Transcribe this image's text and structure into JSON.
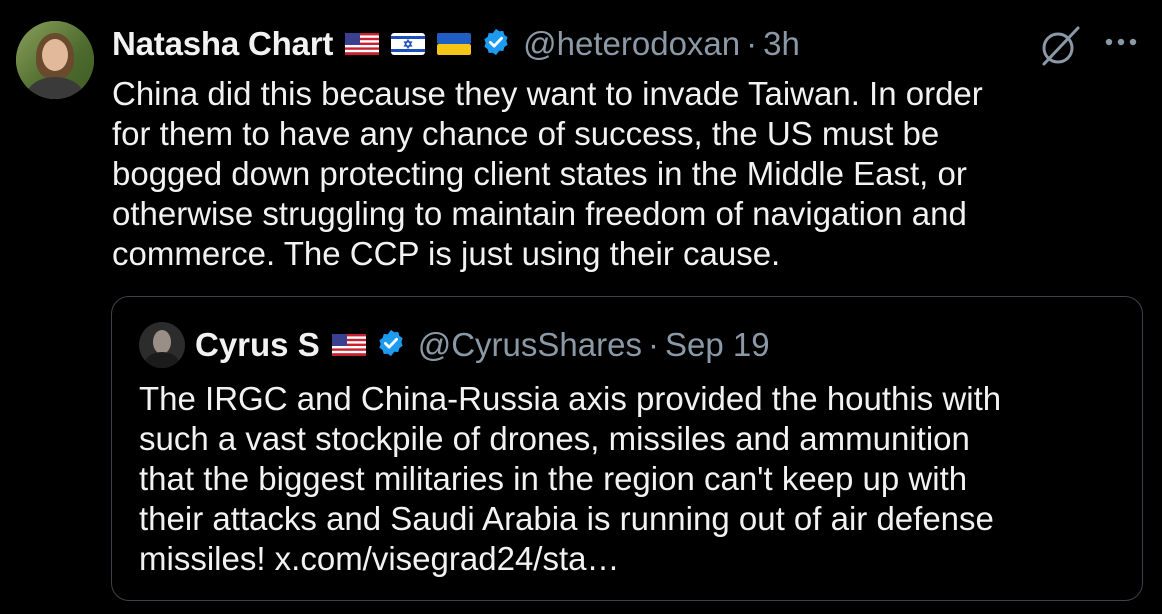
{
  "tweet": {
    "author_name": "Natasha Chart",
    "flags": [
      "us-flag-icon",
      "israel-flag-icon",
      "ukraine-flag-icon"
    ],
    "handle": "@heterodoxan",
    "separator": "·",
    "time": "3h",
    "text": "China did this because they want to invade Taiwan. In order\nfor them to have any chance of success, the US must be\nbogged down protecting client states in the Middle East, or\notherwise struggling to maintain freedom of navigation and\ncommerce. The CCP is just using their cause."
  },
  "quoted": {
    "author_name": "Cyrus S",
    "handle": "@CyrusShares",
    "separator": "·",
    "date": "Sep 19",
    "text": "The IRGC and China-Russia axis provided the houthis with\nsuch a vast stockpile of drones, missiles and ammunition\nthat the biggest militaries in the region can't keep up with\ntheir attacks and Saudi Arabia is running out of air defense\nmissiles! x.com/visegrad24/sta…"
  },
  "colors": {
    "background": "#000000",
    "text": "#f2f2f2",
    "muted": "#8b98a5",
    "verified": "#1d9bf0",
    "border": "#3d4247"
  }
}
